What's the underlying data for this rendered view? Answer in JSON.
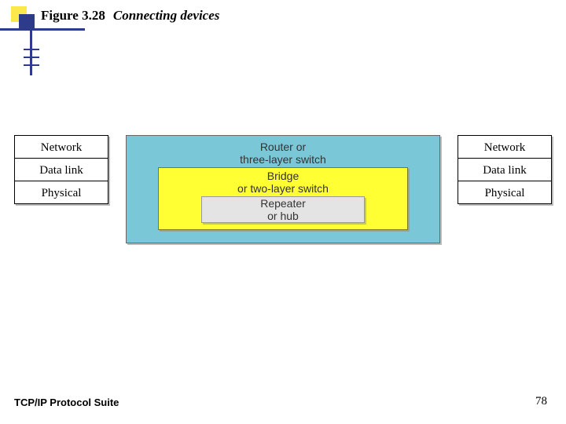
{
  "figure": {
    "number": "Figure 3.28",
    "title": "Connecting devices"
  },
  "left_stack": [
    "Network",
    "Data link",
    "Physical"
  ],
  "right_stack": [
    "Network",
    "Data link",
    "Physical"
  ],
  "center": {
    "router_l1": "Router or",
    "router_l2": "three-layer switch",
    "bridge_l1": "Bridge",
    "bridge_l2": "or two-layer switch",
    "repeater_l1": "Repeater",
    "repeater_l2": "or hub"
  },
  "footer": {
    "left": "TCP/IP Protocol Suite",
    "page": "78"
  }
}
